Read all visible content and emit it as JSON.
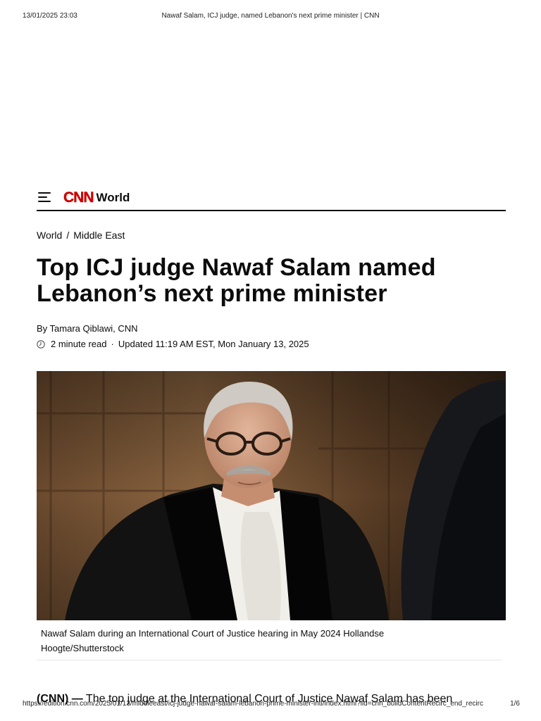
{
  "print": {
    "date": "13/01/2025 23:03",
    "doc_title": "Nawaf Salam, ICJ judge, named Lebanon's next prime minister | CNN",
    "url": "https://edition.cnn.com/2025/01/13/middleeast/icj-judge-nawaf-salam-lebanon-prime-minister-intl/index.html?iid=cnn_buildContentRecirc_end_recirc",
    "page": "1/6"
  },
  "nav": {
    "menu_icon": "hamburger-menu-icon",
    "logo_text": "CNN",
    "section": "World",
    "brand_color": "#cc0000"
  },
  "breadcrumb": {
    "items": [
      "World",
      "Middle East"
    ],
    "separator": "/"
  },
  "article": {
    "headline": "Top ICJ judge Nawaf Salam named Lebanon’s next prime minister",
    "byline": "By Tamara Qiblawi, CNN",
    "read_time": "2 minute read",
    "meta_sep": "·",
    "updated": "Updated 11:19 AM EST, Mon January 13, 2025",
    "clock_icon": "clock-icon",
    "image_caption": "Nawaf Salam during an International Court of Justice hearing in May 2024 Hollandse Hoogte/Shutterstock",
    "lead_source": "(CNN) —",
    "lead_text": " The top judge at the International Court of Justice Nawaf Salam has been"
  }
}
